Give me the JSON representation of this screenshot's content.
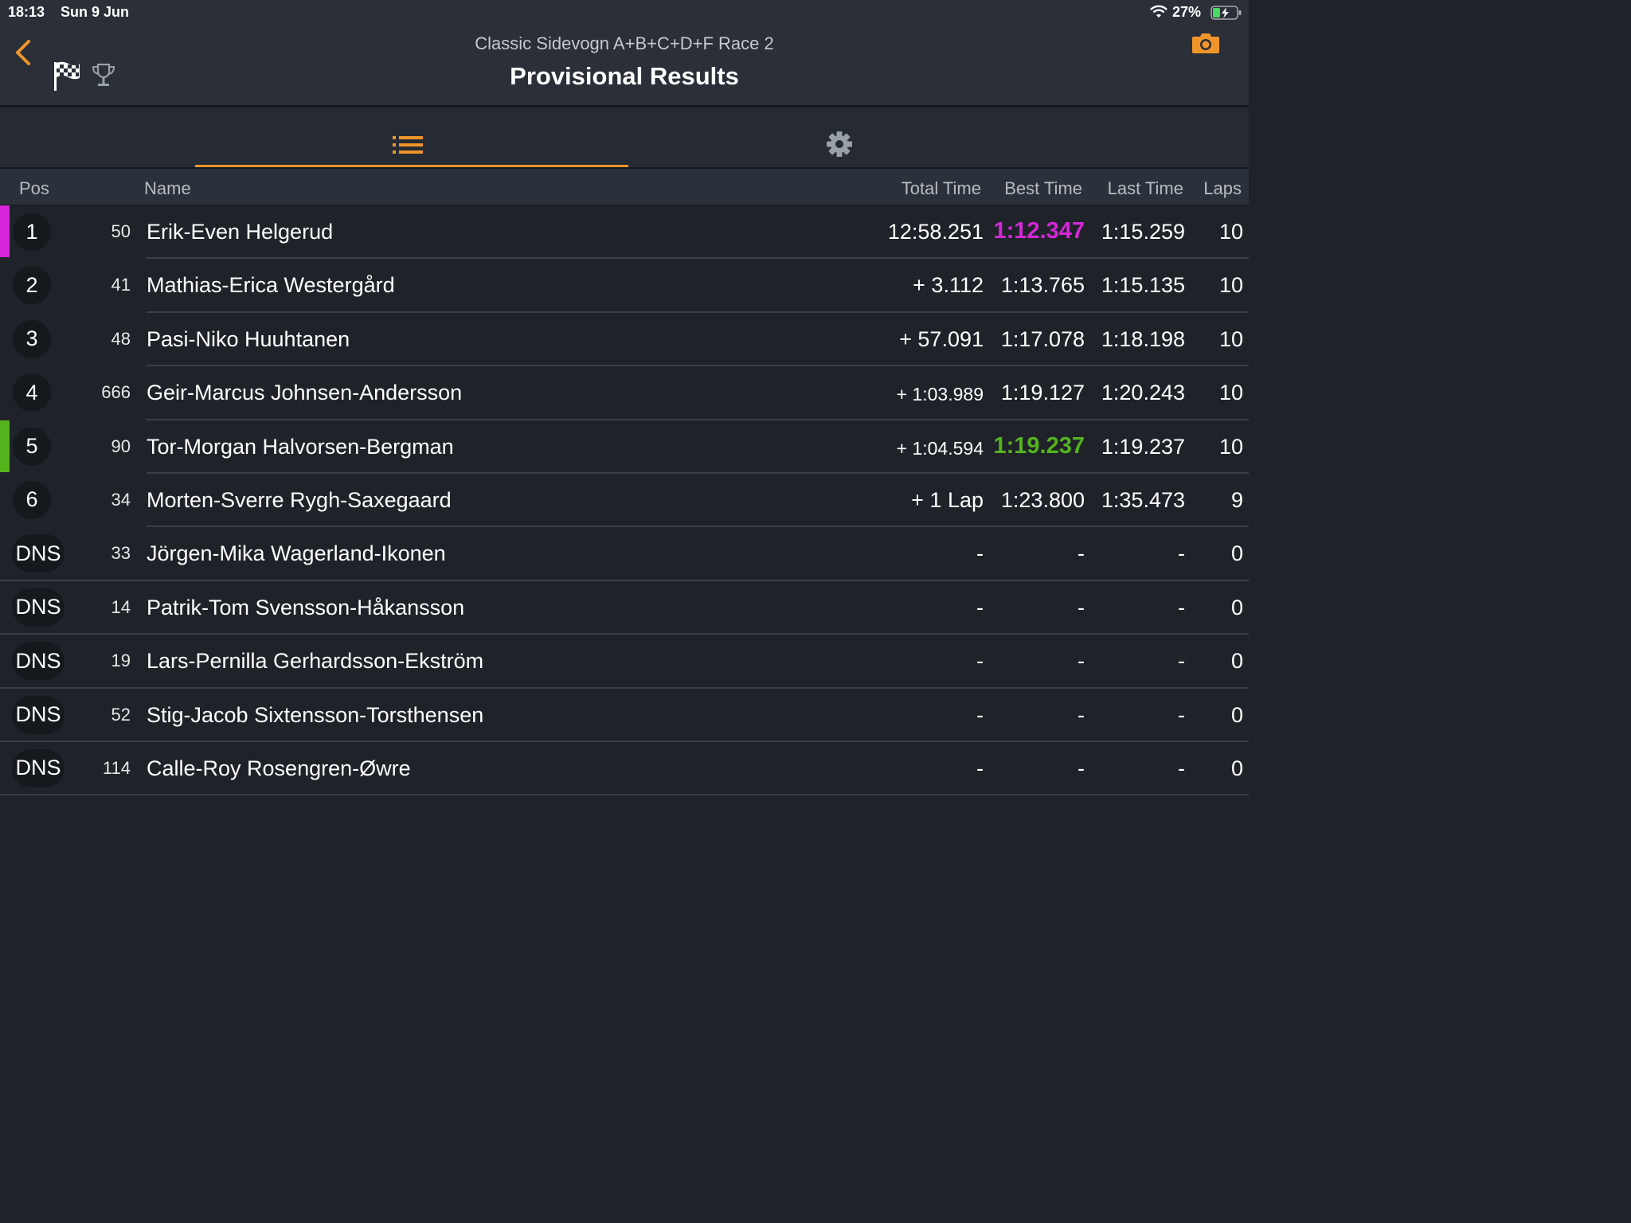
{
  "status_bar": {
    "time": "18:13",
    "date": "Sun 9 Jun",
    "battery": "27%"
  },
  "header": {
    "subtitle": "Classic Sidevogn A+B+C+D+F Race 2",
    "title": "Provisional Results"
  },
  "columns": {
    "pos": "Pos",
    "name": "Name",
    "total": "Total Time",
    "best": "Best Time",
    "last": "Last Time",
    "laps": "Laps"
  },
  "colors": {
    "accent": "#f0952a",
    "fastest_lap": "#d726d9",
    "personal_best": "#55b31e"
  },
  "rows": [
    {
      "pos": "1",
      "num": "50",
      "name": "Erik-Even Helgerud",
      "total": "12:58.251",
      "best": "1:12.347",
      "last": "1:15.259",
      "laps": "10",
      "highlight": "purple"
    },
    {
      "pos": "2",
      "num": "41",
      "name": "Mathias-Erica Westergård",
      "total": "+ 3.112",
      "best": "1:13.765",
      "last": "1:15.135",
      "laps": "10"
    },
    {
      "pos": "3",
      "num": "48",
      "name": "Pasi-Niko Huuhtanen",
      "total": "+ 57.091",
      "best": "1:17.078",
      "last": "1:18.198",
      "laps": "10"
    },
    {
      "pos": "4",
      "num": "666",
      "name": "Geir-Marcus Johnsen-Andersson",
      "total": "+ 1:03.989",
      "best": "1:19.127",
      "last": "1:20.243",
      "laps": "10"
    },
    {
      "pos": "5",
      "num": "90",
      "name": "Tor-Morgan Halvorsen-Bergman",
      "total": "+ 1:04.594",
      "best": "1:19.237",
      "last": "1:19.237",
      "laps": "10",
      "highlight": "green"
    },
    {
      "pos": "6",
      "num": "34",
      "name": "Morten-Sverre Rygh-Saxegaard",
      "total": "+ 1 Lap",
      "best": "1:23.800",
      "last": "1:35.473",
      "laps": "9"
    },
    {
      "pos": "DNS",
      "num": "33",
      "name": "Jörgen-Mika Wagerland-Ikonen",
      "total": "-",
      "best": "-",
      "last": "-",
      "laps": "0"
    },
    {
      "pos": "DNS",
      "num": "14",
      "name": "Patrik-Tom Svensson-Håkansson",
      "total": "-",
      "best": "-",
      "last": "-",
      "laps": "0"
    },
    {
      "pos": "DNS",
      "num": "19",
      "name": "Lars-Pernilla Gerhardsson-Ekström",
      "total": "-",
      "best": "-",
      "last": "-",
      "laps": "0"
    },
    {
      "pos": "DNS",
      "num": "52",
      "name": "Stig-Jacob Sixtensson-Torsthensen",
      "total": "-",
      "best": "-",
      "last": "-",
      "laps": "0"
    },
    {
      "pos": "DNS",
      "num": "114",
      "name": "Calle-Roy Rosengren-Øwre",
      "total": "-",
      "best": "-",
      "last": "-",
      "laps": "0"
    }
  ]
}
